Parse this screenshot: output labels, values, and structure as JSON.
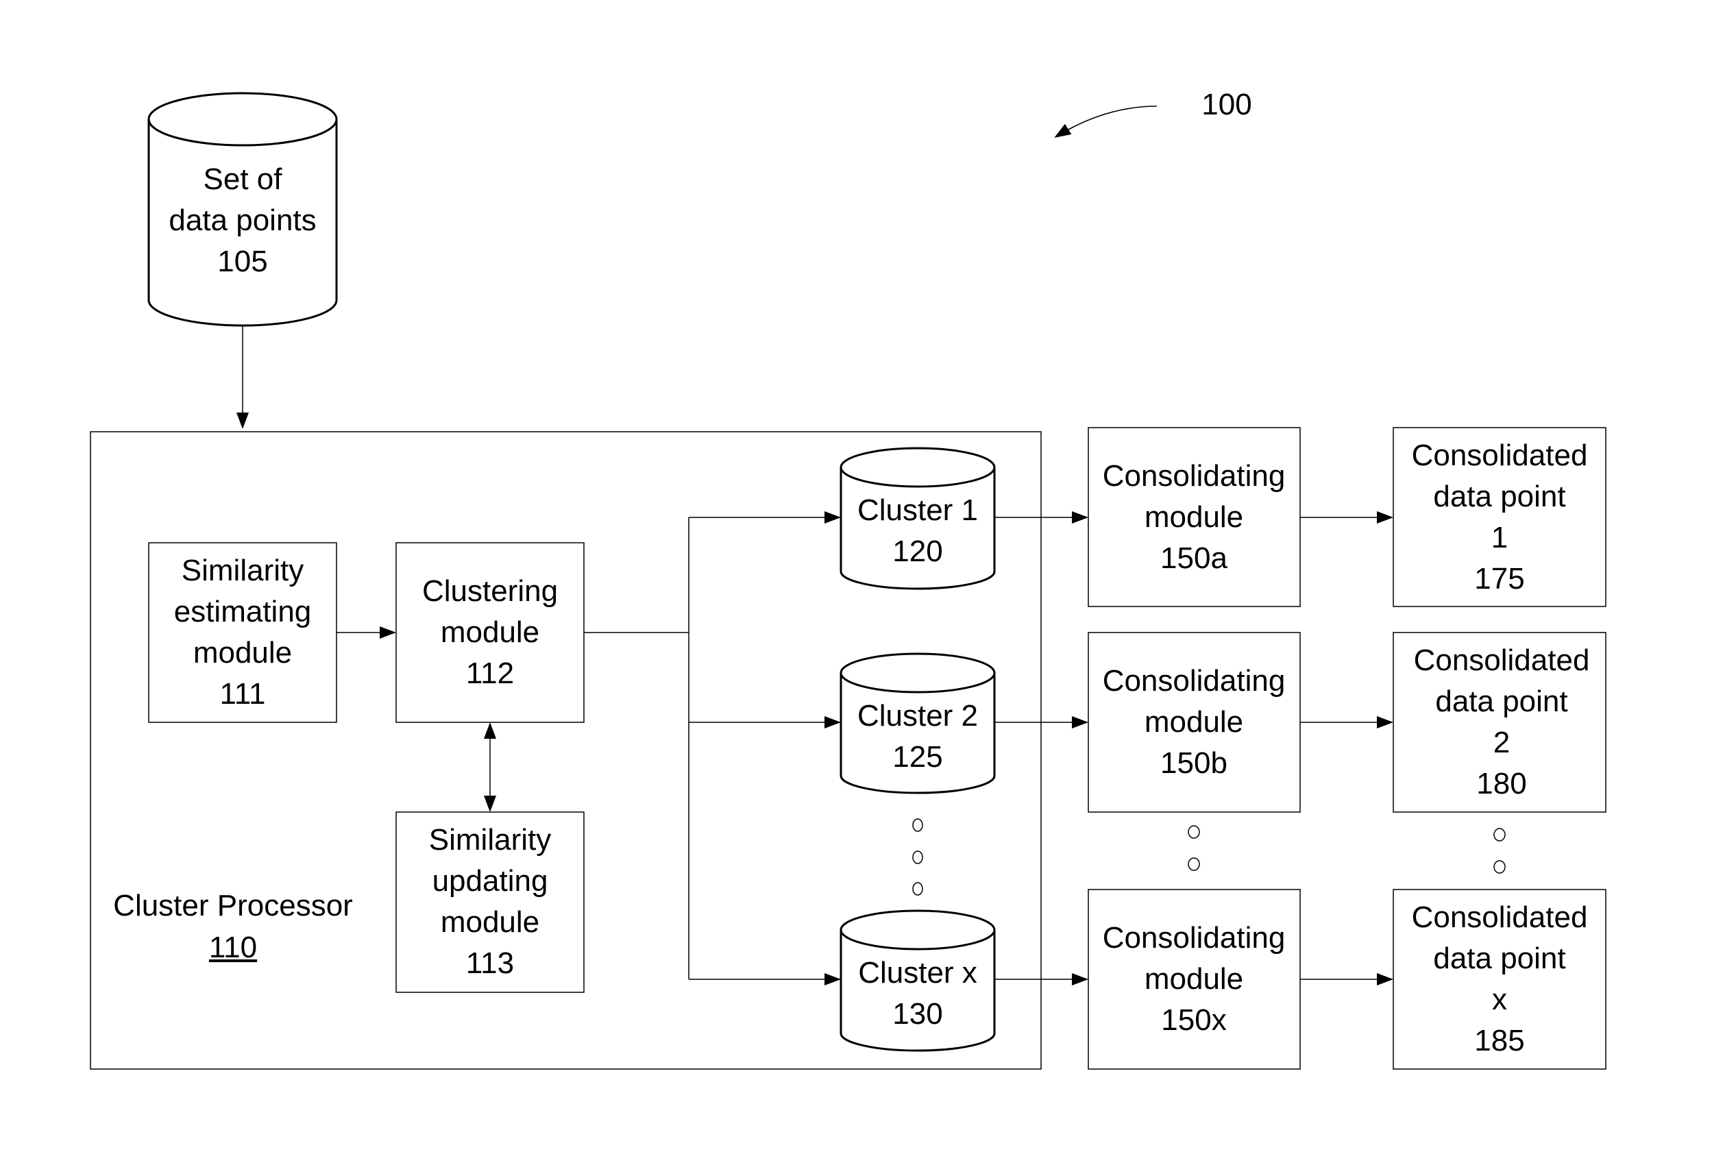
{
  "figure_ref": "100",
  "data_source": {
    "lines": [
      "Set of",
      "data points",
      "105"
    ]
  },
  "cluster_processor": {
    "label": "Cluster Processor",
    "ref": "110"
  },
  "modules": {
    "similarity_estimating": {
      "lines": [
        "Similarity",
        "estimating",
        "module",
        "111"
      ]
    },
    "clustering": {
      "lines": [
        "Clustering",
        "module",
        "112"
      ]
    },
    "similarity_updating": {
      "lines": [
        "Similarity",
        "updating",
        "module",
        "113"
      ]
    }
  },
  "clusters": [
    {
      "lines": [
        "Cluster 1",
        "120"
      ]
    },
    {
      "lines": [
        "Cluster 2",
        "125"
      ]
    },
    {
      "lines": [
        "Cluster x",
        "130"
      ]
    }
  ],
  "consolidating_modules": [
    {
      "lines": [
        "Consolidating",
        "module",
        "150a"
      ]
    },
    {
      "lines": [
        "Consolidating",
        "module",
        "150b"
      ]
    },
    {
      "lines": [
        "Consolidating",
        "module",
        "150x"
      ]
    }
  ],
  "consolidated_points": [
    {
      "lines": [
        "Consolidated",
        "data point",
        "1",
        "175"
      ]
    },
    {
      "lines": [
        "Consolidated",
        "data point",
        "2",
        "180"
      ]
    },
    {
      "lines": [
        "Consolidated",
        "data point",
        "x",
        "185"
      ]
    }
  ]
}
